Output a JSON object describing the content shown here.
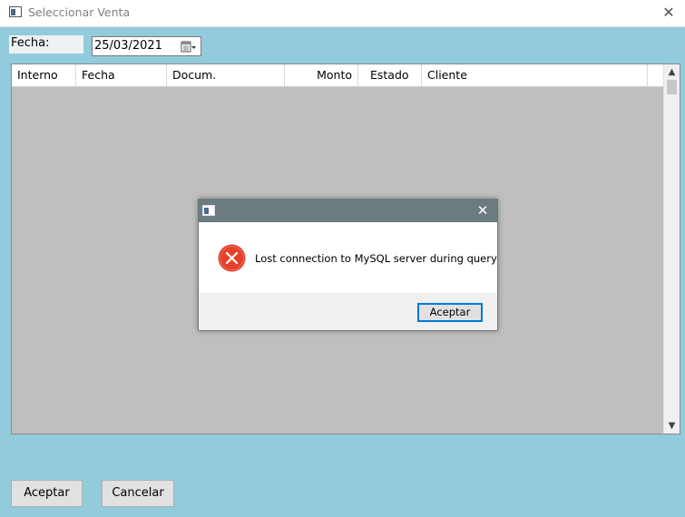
{
  "window": {
    "title": "Seleccionar Venta",
    "close_glyph": "✕"
  },
  "filter": {
    "fecha_label": "Fecha:",
    "date_value": "25/03/2021"
  },
  "grid": {
    "columns": [
      {
        "label": "Interno"
      },
      {
        "label": "Fecha"
      },
      {
        "label": "Docum."
      },
      {
        "label": "Monto"
      },
      {
        "label": "Estado"
      },
      {
        "label": "Cliente"
      }
    ],
    "rows": []
  },
  "scrollbar": {
    "up_glyph": "▲",
    "down_glyph": "▼"
  },
  "buttons": {
    "accept": "Aceptar",
    "cancel": "Cancelar"
  },
  "dialog": {
    "message": "Lost connection to MySQL server during query",
    "ok": "Aceptar",
    "close_glyph": "✕",
    "error_color": "#e5402a"
  }
}
